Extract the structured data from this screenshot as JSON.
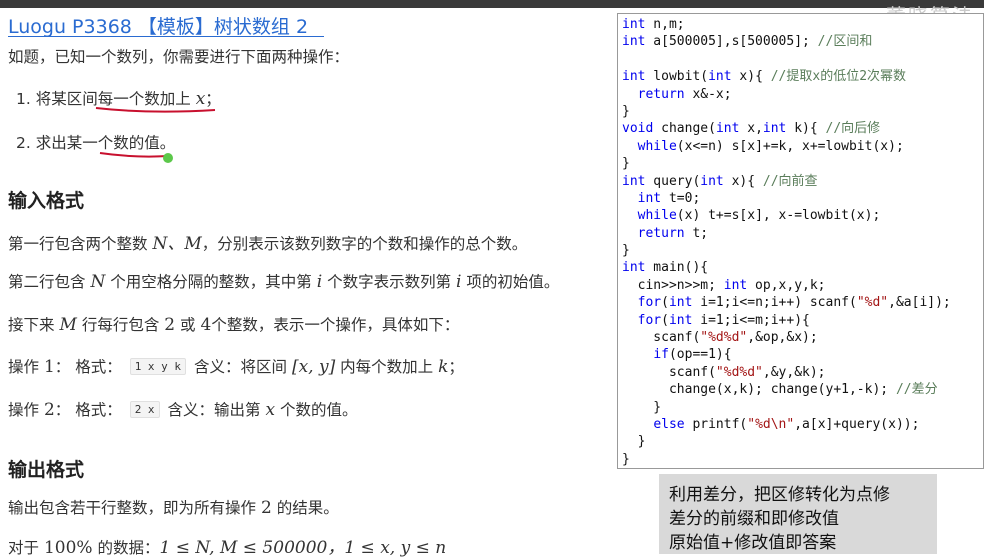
{
  "watermark": "董晓算法",
  "title": "Luogu P3368 【模板】树状数组 2",
  "intro": "如题，已知一个数列，你需要进行下面两种操作：",
  "ops_list": {
    "op1_num": "1.",
    "op1_text": "将某区间每一个数加上",
    "op1_var": "x",
    "op1_end": "；",
    "op2_num": "2.",
    "op2_text": "求出某一个数的值。"
  },
  "input_section": {
    "heading": "输入格式",
    "line1_a": "第一行包含两个整数",
    "line1_vars": "N、M",
    "line1_b": "，分别表示该数列数字的个数和操作的总个数。",
    "line2_a": "第二行包含",
    "line2_var1": "N",
    "line2_b": "个用空格分隔的整数，其中第",
    "line2_var2": "i",
    "line2_c": "个数字表示数列第",
    "line2_var3": "i",
    "line2_d": "项的初始值。",
    "line3_a": "接下来",
    "line3_var": "M",
    "line3_b": "行每行包含",
    "line3_n2": "2",
    "line3_c": "或",
    "line3_n4": "4",
    "line3_d": "个整数，表示一个操作，具体如下：",
    "op1_label": "操作",
    "op1_n": "1",
    "op1_colon": "：",
    "op1_fmt_label": "格式：",
    "op1_code": "1 x y k",
    "op1_meaning_a": "含义：将区间",
    "op1_range": "[x, y]",
    "op1_meaning_b": "内每个数加上",
    "op1_k": "k",
    "op1_end": "；",
    "op2_label": "操作",
    "op2_n": "2",
    "op2_colon": "：",
    "op2_fmt_label": "格式：",
    "op2_code": "2 x",
    "op2_meaning_a": "含义：输出第",
    "op2_x": "x",
    "op2_meaning_b": "个数的值。"
  },
  "output_section": {
    "heading": "输出格式",
    "line1_a": "输出包含若干行整数，即为所有操作",
    "line1_n": "2",
    "line1_b": "的结果。",
    "line2_a": "对于",
    "line2_pct": "100%",
    "line2_b": "的数据：",
    "line2_math": "1 ≤ N, M ≤ 500000，1 ≤ x, y ≤ n"
  },
  "code_lines": [
    "int n,m;",
    "int a[500005],s[500005]; //区间和",
    "",
    "int lowbit(int x){ //提取x的低位2次幂数",
    "  return x&-x;",
    "}",
    "void change(int x,int k){ //向后修",
    "  while(x<=n) s[x]+=k, x+=lowbit(x);",
    "}",
    "int query(int x){ //向前查",
    "  int t=0;",
    "  while(x) t+=s[x], x-=lowbit(x);",
    "  return t;",
    "}",
    "int main(){",
    "  cin>>n>>m; int op,x,y,k;",
    "  for(int i=1;i<=n;i++) scanf(\"%d\",&a[i]);",
    "  for(int i=1;i<=m;i++){",
    "    scanf(\"%d%d\",&op,&x);",
    "    if(op==1){",
    "      scanf(\"%d%d\",&y,&k);",
    "      change(x,k); change(y+1,-k); //差分",
    "    }",
    "    else printf(\"%d\\n\",a[x]+query(x));",
    "  }",
    "}"
  ],
  "note_lines": [
    "利用差分，把区修转化为点修",
    "差分的前缀和即修改值",
    "原始值+修改值即答案"
  ],
  "colors": {
    "title": "#2a6bd1",
    "annotation_red": "#c8102e",
    "pointer_green": "#5cc84a",
    "note_bg": "#d9d9d9"
  }
}
